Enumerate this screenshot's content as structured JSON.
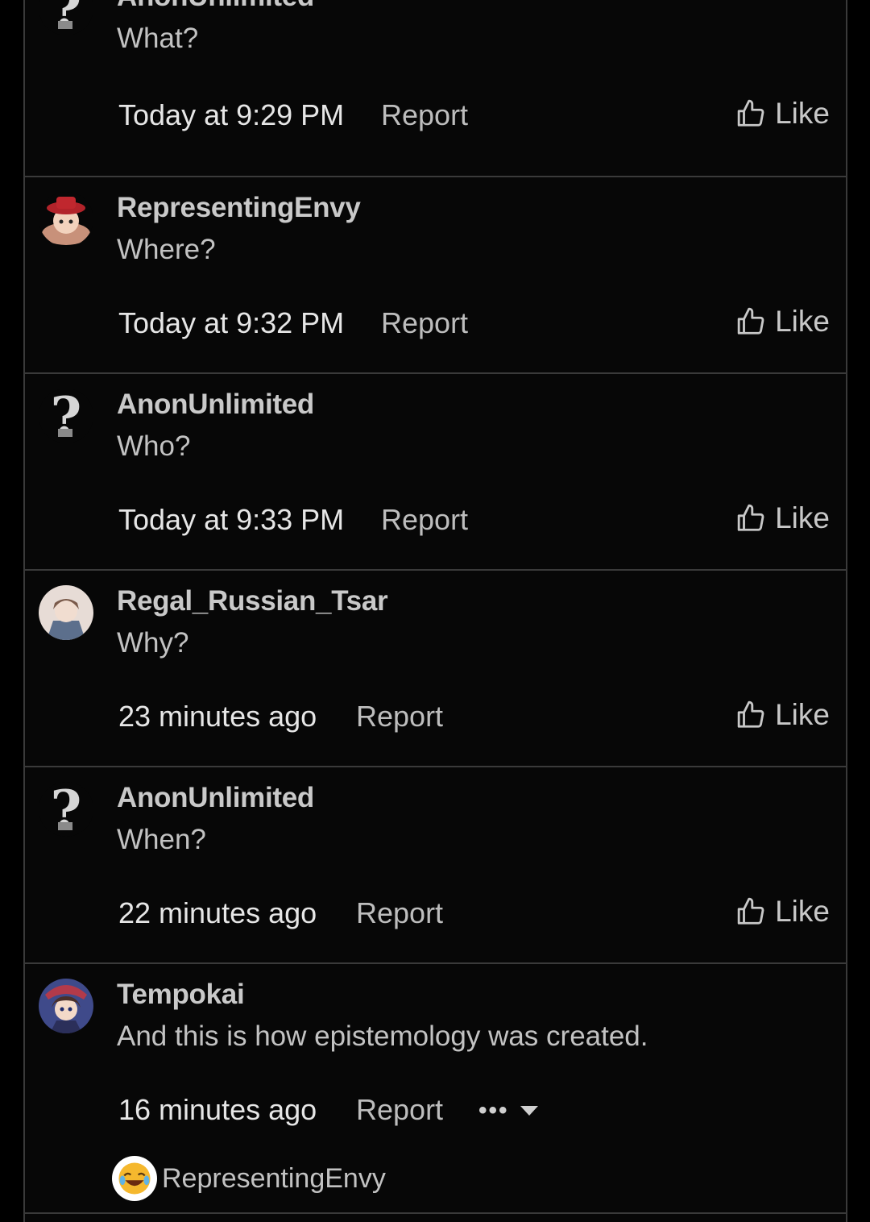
{
  "posts": [
    {
      "username": "AnonUnlimited",
      "message": "What?",
      "time": "Today at 9:29 PM",
      "report": "Report",
      "like": "Like",
      "avatar": "question-mark-avatar"
    },
    {
      "username": "RepresentingEnvy",
      "message": "Where?",
      "time": "Today at 9:32 PM",
      "report": "Report",
      "like": "Like",
      "avatar": "red-hat-character-avatar"
    },
    {
      "username": "AnonUnlimited",
      "message": "Who?",
      "time": "Today at 9:33 PM",
      "report": "Report",
      "like": "Like",
      "avatar": "question-mark-avatar"
    },
    {
      "username": "Regal_Russian_Tsar",
      "message": "Why?",
      "time": "23 minutes ago",
      "report": "Report",
      "like": "Like",
      "avatar": "anime-portrait-avatar"
    },
    {
      "username": "AnonUnlimited",
      "message": "When?",
      "time": "22 minutes ago",
      "report": "Report",
      "like": "Like",
      "avatar": "question-mark-avatar"
    },
    {
      "username": "Tempokai",
      "message": "And this is how epistemology was created.",
      "time": "16 minutes ago",
      "report": "Report",
      "more": "•••",
      "avatar": "anime-girl-avatar",
      "reaction": {
        "icon": "laughing-emoji-icon",
        "user": "RepresentingEnvy"
      }
    }
  ],
  "colors": {
    "background": "#000000",
    "panel": "#070707",
    "divider": "#3a3a3a",
    "text": "#c9c9c9"
  }
}
